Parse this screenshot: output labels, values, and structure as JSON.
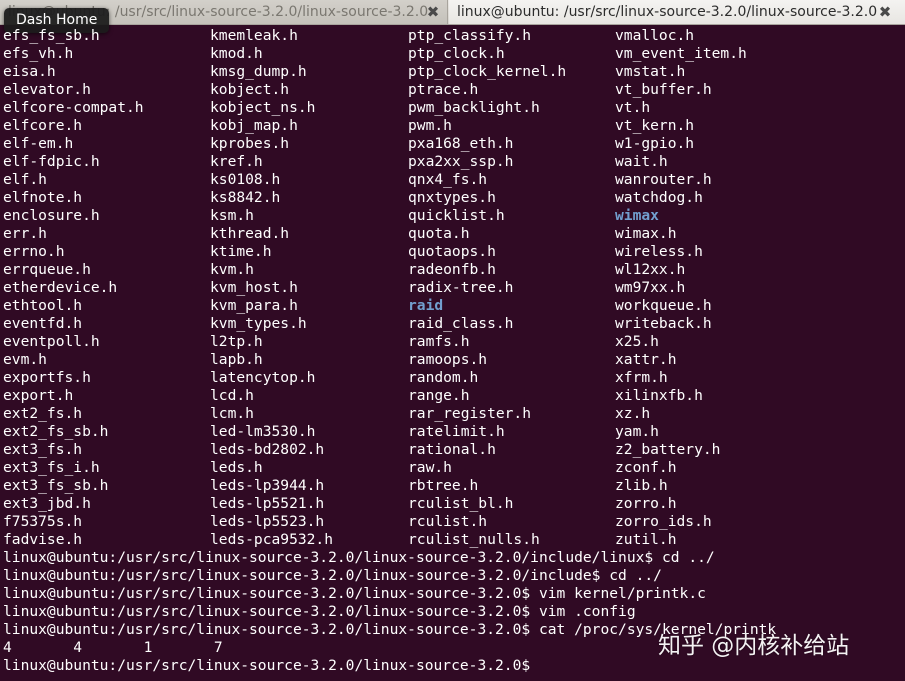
{
  "tabs": [
    {
      "label": "linux@ubuntu: /usr/src/linux-source-3.2.0/linux-source-3.2.0",
      "active": false
    },
    {
      "label": "linux@ubuntu: /usr/src/linux-source-3.2.0/linux-source-3.2.0",
      "active": true
    }
  ],
  "tooltip": "Dash Home",
  "colors": {
    "background": "#300a24",
    "text": "#ffffff",
    "directory": "#729fcf"
  },
  "listing": {
    "col1": [
      "efs_fs_sb.h",
      "efs_vh.h",
      "eisa.h",
      "elevator.h",
      "elfcore-compat.h",
      "elfcore.h",
      "elf-em.h",
      "elf-fdpic.h",
      "elf.h",
      "elfnote.h",
      "enclosure.h",
      "err.h",
      "errno.h",
      "errqueue.h",
      "etherdevice.h",
      "ethtool.h",
      "eventfd.h",
      "eventpoll.h",
      "evm.h",
      "exportfs.h",
      "export.h",
      "ext2_fs.h",
      "ext2_fs_sb.h",
      "ext3_fs.h",
      "ext3_fs_i.h",
      "ext3_fs_sb.h",
      "ext3_jbd.h",
      "f75375s.h",
      "fadvise.h"
    ],
    "col2": [
      "kmemleak.h",
      "kmod.h",
      "kmsg_dump.h",
      "kobject.h",
      "kobject_ns.h",
      "kobj_map.h",
      "kprobes.h",
      "kref.h",
      "ks0108.h",
      "ks8842.h",
      "ksm.h",
      "kthread.h",
      "ktime.h",
      "kvm.h",
      "kvm_host.h",
      "kvm_para.h",
      "kvm_types.h",
      "l2tp.h",
      "lapb.h",
      "latencytop.h",
      "lcd.h",
      "lcm.h",
      "led-lm3530.h",
      "leds-bd2802.h",
      "leds.h",
      "leds-lp3944.h",
      "leds-lp5521.h",
      "leds-lp5523.h",
      "leds-pca9532.h"
    ],
    "col3": [
      "ptp_classify.h",
      "ptp_clock.h",
      "ptp_clock_kernel.h",
      "ptrace.h",
      "pwm_backlight.h",
      "pwm.h",
      "pxa168_eth.h",
      "pxa2xx_ssp.h",
      "qnx4_fs.h",
      "qnxtypes.h",
      "quicklist.h",
      "quota.h",
      "quotaops.h",
      "radeonfb.h",
      "radix-tree.h",
      "raid",
      "raid_class.h",
      "ramfs.h",
      "ramoops.h",
      "random.h",
      "range.h",
      "rar_register.h",
      "ratelimit.h",
      "rational.h",
      "raw.h",
      "rbtree.h",
      "rculist_bl.h",
      "rculist.h",
      "rculist_nulls.h"
    ],
    "col4": [
      "vmalloc.h",
      "vm_event_item.h",
      "vmstat.h",
      "vt_buffer.h",
      "vt.h",
      "vt_kern.h",
      "w1-gpio.h",
      "wait.h",
      "wanrouter.h",
      "watchdog.h",
      "wimax",
      "wimax.h",
      "wireless.h",
      "wl12xx.h",
      "wm97xx.h",
      "workqueue.h",
      "writeback.h",
      "x25.h",
      "xattr.h",
      "xfrm.h",
      "xilinxfb.h",
      "xz.h",
      "yam.h",
      "z2_battery.h",
      "zconf.h",
      "zlib.h",
      "zorro.h",
      "zorro_ids.h",
      "zutil.h"
    ],
    "directories": [
      "raid",
      "wimax"
    ]
  },
  "commands": [
    "linux@ubuntu:/usr/src/linux-source-3.2.0/linux-source-3.2.0/include/linux$ cd ../",
    "linux@ubuntu:/usr/src/linux-source-3.2.0/linux-source-3.2.0/include$ cd ../",
    "linux@ubuntu:/usr/src/linux-source-3.2.0/linux-source-3.2.0$ vim kernel/printk.c",
    "linux@ubuntu:/usr/src/linux-source-3.2.0/linux-source-3.2.0$ vim .config",
    "linux@ubuntu:/usr/src/linux-source-3.2.0/linux-source-3.2.0$ cat /proc/sys/kernel/printk",
    "4       4       1       7",
    "linux@ubuntu:/usr/src/linux-source-3.2.0/linux-source-3.2.0$ "
  ],
  "watermark": "知乎 @内核补给站"
}
